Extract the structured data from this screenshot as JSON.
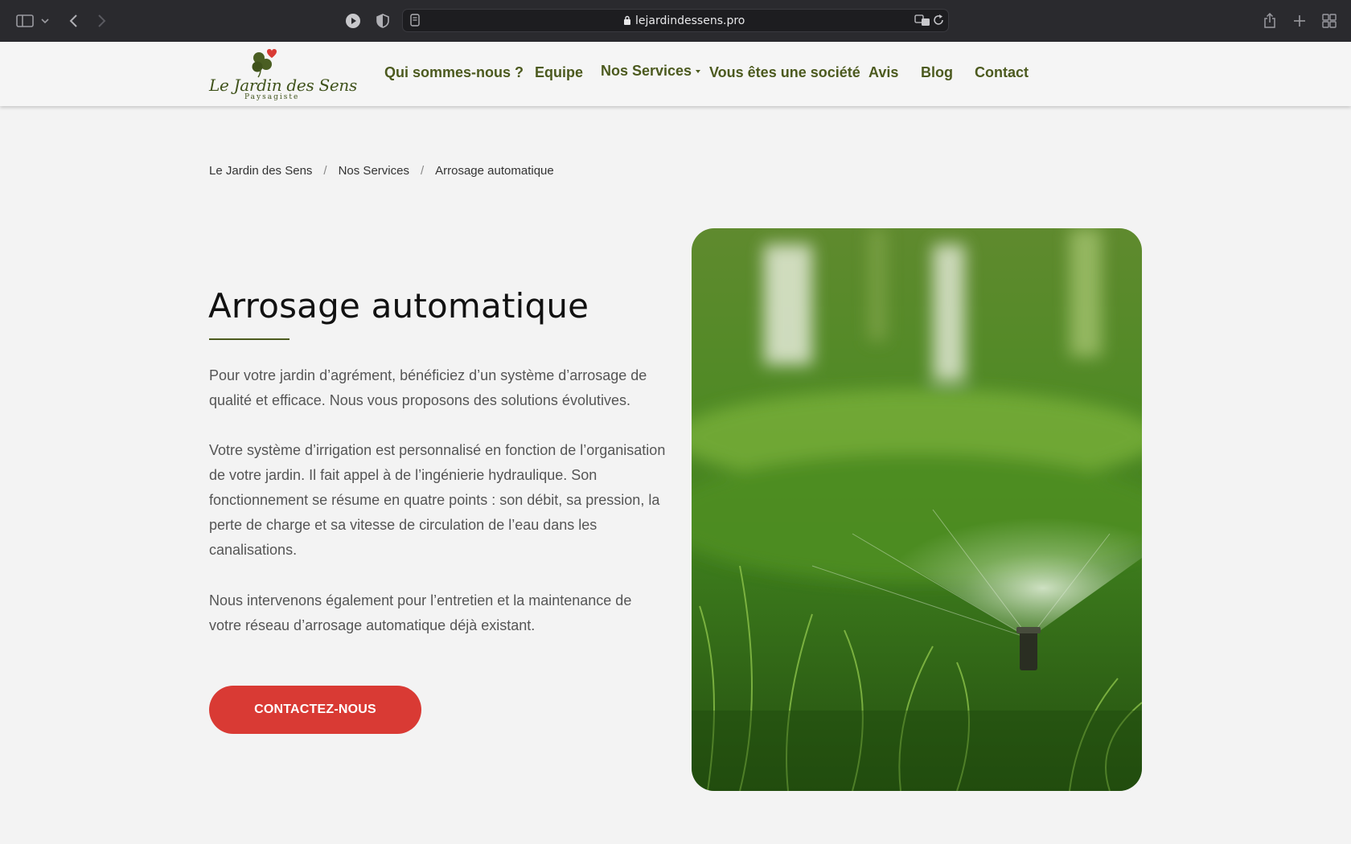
{
  "browser": {
    "url": "lejardindessens.pro"
  },
  "header": {
    "logo": {
      "name": "Le Jardin des Sens",
      "tagline": "Paysagiste"
    },
    "nav": [
      {
        "label": "Qui sommes-nous ?"
      },
      {
        "label": "Equipe"
      },
      {
        "label": "Nos Services"
      },
      {
        "label": "Vous êtes une société"
      },
      {
        "label": "Avis"
      },
      {
        "label": "Blog"
      },
      {
        "label": "Contact"
      }
    ]
  },
  "breadcrumb": [
    {
      "label": "Le Jardin des Sens"
    },
    {
      "label": "Nos Services"
    },
    {
      "label": "Arrosage automatique"
    }
  ],
  "breadcrumb_separator": "/",
  "main": {
    "title": "Arrosage automatique",
    "paragraphs": [
      "Pour votre jardin d’agrément, bénéficiez d’un système d’arrosage de qualité et efficace. Nous vous proposons des solutions évolutives.",
      "Votre système d’irrigation est personnalisé en fonction de l’organisation de votre jardin. Il fait appel à de l’ingénierie hydraulique. Son fonctionnement se résume en quatre points : son débit, sa pression, la perte de charge et sa vitesse de circulation de l’eau dans les canalisations.",
      "Nous intervenons également pour l’entretien et la maintenance de votre réseau d’arrosage automatique déjà existant."
    ],
    "cta_label": "CONTACTEZ-NOUS"
  },
  "colors": {
    "brand_green": "#4c5a1f",
    "cta_red": "#d93a34",
    "page_bg": "#f3f3f3"
  }
}
